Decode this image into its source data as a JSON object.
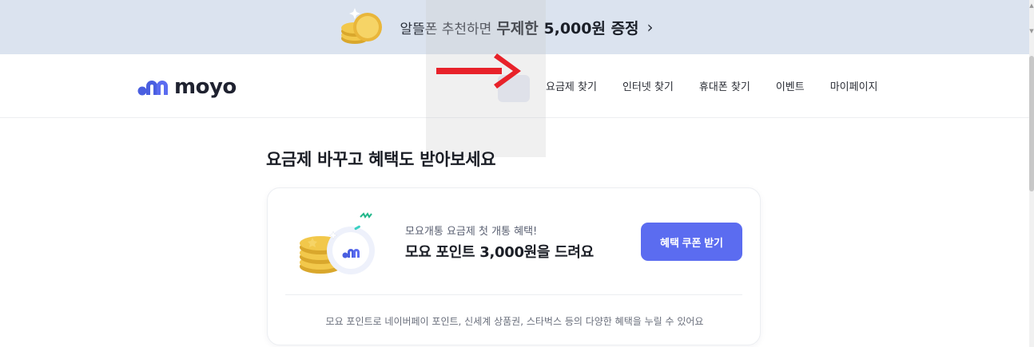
{
  "promo": {
    "text": "알뜰폰 추천하면",
    "highlight": "무제한 5,000원 증정",
    "chevron": "›",
    "icon": "coin-icon"
  },
  "header": {
    "logo_text": "moyo",
    "nav": [
      "요금제 찾기",
      "인터넷 찾기",
      "휴대폰 찾기",
      "이벤트",
      "마이페이지"
    ]
  },
  "main": {
    "title": "요금제 바꾸고 혜택도 받아보세요",
    "card": {
      "subtitle": "모요개통 요금제 첫 개통 혜택!",
      "headline": "모요 포인트 3,000원을 드려요",
      "cta": "혜택 쿠폰 받기",
      "footnote": "모요 포인트로 네이버페이 포인트, 신세계 상품권, 스타벅스 등의 다양한 혜택을 누릴 수 있어요"
    }
  },
  "colors": {
    "banner_bg": "#dbe3ef",
    "accent": "#5b6cf0",
    "arrow": "#e8222a"
  }
}
